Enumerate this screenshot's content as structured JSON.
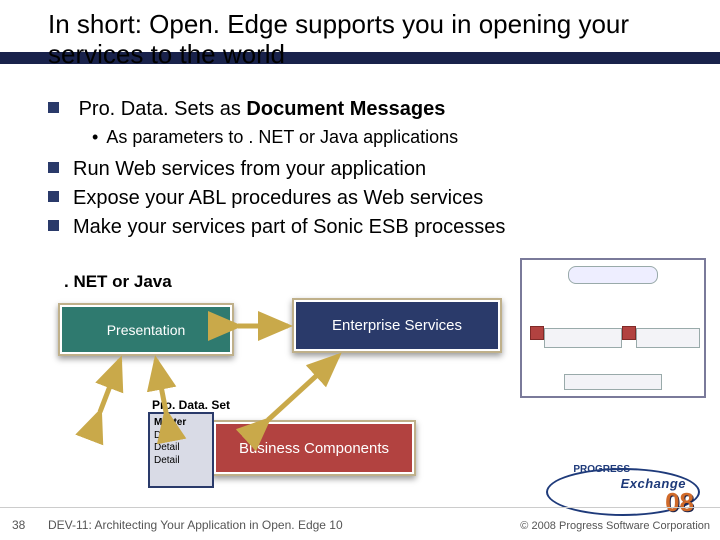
{
  "title": "In short: Open. Edge supports you in opening your services to the world",
  "bullets": {
    "b1_pre": "Pro. Data. Sets as ",
    "b1_bold": "Document Messages",
    "sub1": "As parameters to . NET or Java applications",
    "b2": "Run Web services from your application",
    "b3": "Expose your ABL procedures as Web services",
    "b4": "Make your services part of Sonic ESB processes"
  },
  "labels": {
    "netjava": ". NET or Java",
    "presentation": "Presentation",
    "enterprise": "Enterprise Services",
    "business": "Business Components",
    "pds": "Pro. Data. Set",
    "pds_rows": [
      "Master",
      "Detail",
      "Detail",
      "Detail"
    ]
  },
  "footer": {
    "page": "38",
    "session": "DEV-11: Architecting Your Application in Open. Edge 10",
    "copyright": "© 2008 Progress Software Corporation"
  },
  "logo": {
    "progress": "PROGRESS",
    "exchange": "Exchange",
    "year": "08"
  }
}
